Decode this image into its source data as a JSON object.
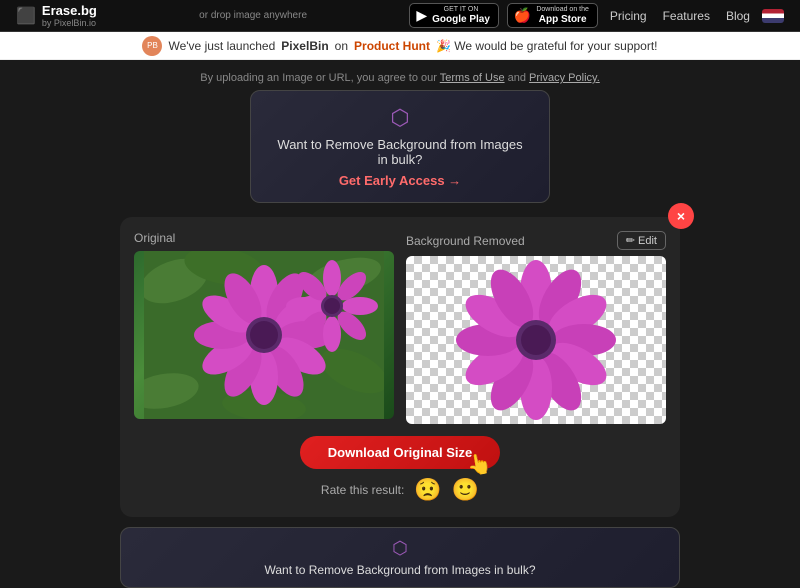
{
  "header": {
    "logo_text": "Erase.bg",
    "logo_sub": "by PixelBin.io",
    "center_text": "or drop image anywhere",
    "google_play_top": "GET IT ON",
    "google_play_bottom": "Google Play",
    "app_store_top": "Download on the",
    "app_store_bottom": "App Store",
    "nav": [
      "Pricing",
      "Features",
      "Blog"
    ]
  },
  "ph_banner": {
    "text_before": "We've just launched",
    "brand": "PixelBin",
    "text_mid": "on",
    "product_hunt": "Product Hunt",
    "text_after": "🎉 We would be grateful for your support!"
  },
  "upload_hint": {
    "text": "By uploading an Image or URL, you agree to our",
    "terms": "Terms of Use",
    "and": "and",
    "privacy": "Privacy Policy."
  },
  "bulk_banner": {
    "icon": "✕",
    "title": "Want to Remove Background from Images in bulk?",
    "cta": "Get Early Access →"
  },
  "result": {
    "original_label": "Original",
    "removed_label": "Background Removed",
    "edit_label": "✏ Edit",
    "close_label": "×"
  },
  "download": {
    "button_label": "Download Original Size",
    "rate_text": "Rate this result:"
  },
  "bottom_bulk": {
    "icon": "✕",
    "title": "Want to Remove Background from Images in bulk?"
  }
}
